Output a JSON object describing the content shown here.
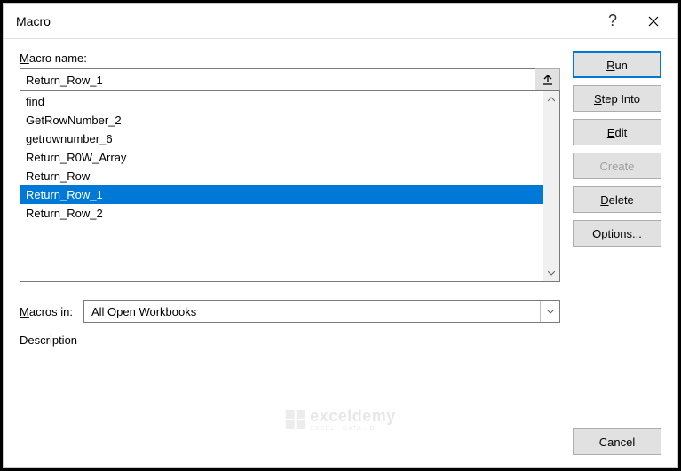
{
  "titlebar": {
    "title": "Macro"
  },
  "labels": {
    "macro_name": "acro name:",
    "macro_name_prefix": "M",
    "macros_in": "acros in:",
    "macros_in_prefix": "M",
    "description": "Description"
  },
  "macro_name_value": "Return_Row_1",
  "macro_list": [
    "find",
    "GetRowNumber_2",
    "getrownumber_6",
    "Return_R0W_Array",
    "Return_Row",
    "Return_Row_1",
    "Return_Row_2"
  ],
  "selected_index": 5,
  "macros_in_value": "All Open Workbooks",
  "buttons": {
    "run": "un",
    "run_prefix": "R",
    "step_into": "tep Into",
    "step_into_prefix": "S",
    "edit": "dit",
    "edit_prefix": "E",
    "create": "reate",
    "create_prefix": "C",
    "delete": "elete",
    "delete_prefix": "D",
    "options": "ptions...",
    "options_prefix": "O",
    "cancel": "Cancel"
  },
  "watermark": {
    "text": "exceldemy",
    "sub": "EXCEL · DATA · BI"
  }
}
